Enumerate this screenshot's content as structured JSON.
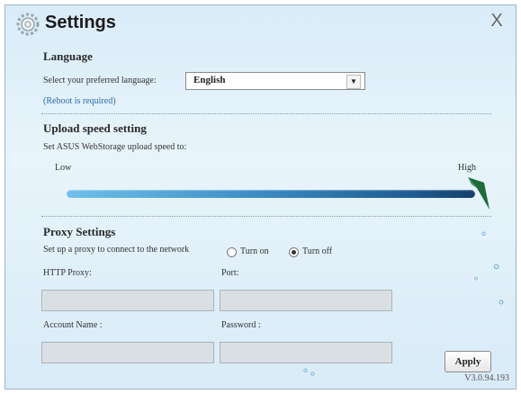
{
  "window": {
    "title": "Settings",
    "close_label": "X",
    "version": "V3.0.94.193"
  },
  "language": {
    "section_title": "Language",
    "prompt": "Select your preferred language:",
    "selected": "English",
    "reboot_note": "(Reboot is required)"
  },
  "upload": {
    "section_title": "Upload speed setting",
    "prompt": "Set ASUS WebStorage upload speed to:",
    "low_label": "Low",
    "high_label": "High",
    "speed_level_fraction": 1.0
  },
  "proxy": {
    "section_title": "Proxy Settings",
    "prompt": "Set up a proxy to connect to the network",
    "turn_on_label": "Turn on",
    "turn_off_label": "Turn off",
    "selected": "Turn off",
    "http_proxy_label": "HTTP Proxy:",
    "port_label": "Port:",
    "account_name_label": "Account Name :",
    "password_label": "Password :",
    "http_proxy_value": "",
    "port_value": "",
    "account_name_value": "",
    "password_value": ""
  },
  "apply_label": "Apply",
  "colors": {
    "accent_dark": "#163f6b",
    "accent_light": "#6fc1ea",
    "handle": "#1f6b3a"
  }
}
